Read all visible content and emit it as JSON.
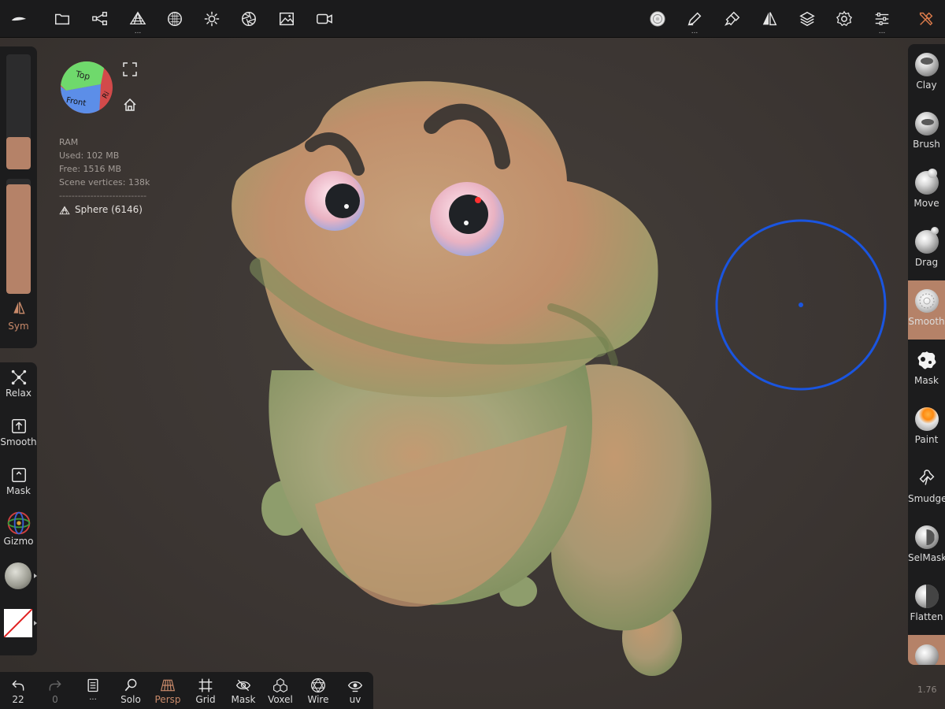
{
  "toolbar_top": {
    "items": [
      {
        "name": "logo-icon"
      },
      {
        "name": "files-icon"
      },
      {
        "name": "scene-icon"
      },
      {
        "name": "topology-icon",
        "has_more": true
      },
      {
        "name": "material-icon"
      },
      {
        "name": "lighting-icon"
      },
      {
        "name": "camera-icon"
      },
      {
        "name": "background-icon"
      },
      {
        "name": "video-icon"
      }
    ],
    "right_items": [
      {
        "name": "current-tool-icon"
      },
      {
        "name": "stroke-icon",
        "has_more": true
      },
      {
        "name": "painting-icon"
      },
      {
        "name": "symmetry-icon"
      },
      {
        "name": "layers-icon"
      },
      {
        "name": "settings-icon"
      },
      {
        "name": "interface-icon",
        "has_more": true
      },
      {
        "name": "tools-icon"
      }
    ],
    "more_dots": "..."
  },
  "left_panel": {
    "radius_level": 0.28,
    "intensity_level": 0.95,
    "sym_label": "Sym",
    "tools": [
      {
        "label": "Relax",
        "icon": "relax-icon"
      },
      {
        "label": "Smooth",
        "icon": "smooth-icon"
      },
      {
        "label": "Mask",
        "icon": "mask-icon"
      },
      {
        "label": "Gizmo",
        "icon": "gizmo-icon"
      }
    ]
  },
  "view_cube": {
    "top": "Top",
    "front": "Front",
    "right": "Ri"
  },
  "info": {
    "ram_label": "RAM",
    "used": "Used: 102 MB",
    "free": "Free: 1516 MB",
    "vertices": "Scene vertices: 138k",
    "separator": "----------------------------",
    "object": "Sphere (6146)"
  },
  "right_tools": [
    {
      "label": "Clay"
    },
    {
      "label": "Brush"
    },
    {
      "label": "Move"
    },
    {
      "label": "Drag"
    },
    {
      "label": "Smooth",
      "active": true
    },
    {
      "label": "Mask"
    },
    {
      "label": "Paint"
    },
    {
      "label": "Smudge"
    },
    {
      "label": "SelMask"
    },
    {
      "label": "Flatten"
    }
  ],
  "bottom_bar": {
    "undo_count": "22",
    "redo_count": "0",
    "more": "...",
    "items": [
      {
        "label": "Solo",
        "icon": "solo-icon"
      },
      {
        "label": "Persp",
        "icon": "persp-icon",
        "active": true
      },
      {
        "label": "Grid",
        "icon": "grid-icon"
      },
      {
        "label": "Mask",
        "icon": "mask-visibility-icon"
      },
      {
        "label": "Voxel",
        "icon": "voxel-icon"
      },
      {
        "label": "Wire",
        "icon": "wire-icon"
      },
      {
        "label": "uv",
        "icon": "uv-icon"
      }
    ]
  },
  "colors": {
    "accent": "#b58268",
    "brush_cursor": "#1a55e0"
  },
  "version": "1.76"
}
